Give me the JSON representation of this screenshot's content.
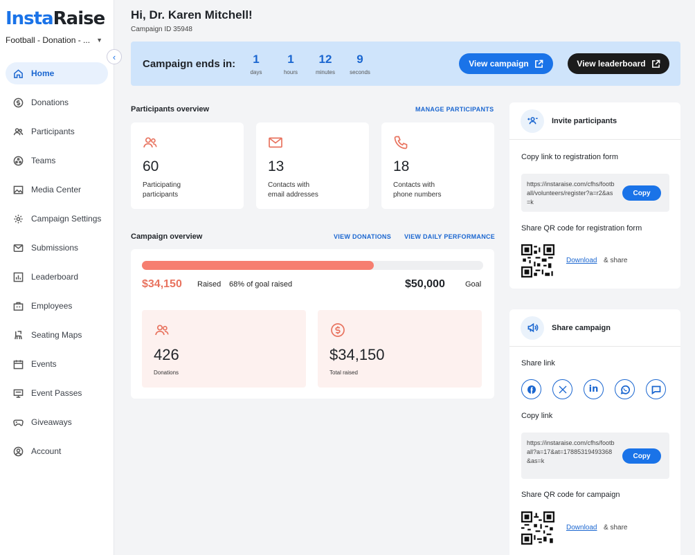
{
  "brand": {
    "part1": "Insta",
    "part2": "Raise"
  },
  "campaign_selector": {
    "value": "Football - Donation - ..."
  },
  "sidebar": {
    "items": [
      {
        "label": "Home",
        "icon": "home-icon"
      },
      {
        "label": "Donations",
        "icon": "dollar-circle-icon"
      },
      {
        "label": "Participants",
        "icon": "people-icon"
      },
      {
        "label": "Teams",
        "icon": "teams-icon"
      },
      {
        "label": "Media Center",
        "icon": "image-icon"
      },
      {
        "label": "Campaign Settings",
        "icon": "gear-icon"
      },
      {
        "label": "Submissions",
        "icon": "mail-icon"
      },
      {
        "label": "Leaderboard",
        "icon": "chart-icon"
      },
      {
        "label": "Employees",
        "icon": "briefcase-icon"
      },
      {
        "label": "Seating Maps",
        "icon": "seat-icon"
      },
      {
        "label": "Events",
        "icon": "calendar-icon"
      },
      {
        "label": "Event Passes",
        "icon": "pass-icon"
      },
      {
        "label": "Giveaways",
        "icon": "gamepad-icon"
      },
      {
        "label": "Account",
        "icon": "user-circle-icon"
      }
    ]
  },
  "header": {
    "greeting": "Hi, Dr. Karen Mitchell!",
    "campaign_id": "Campaign ID 35948"
  },
  "banner": {
    "label": "Campaign ends in:",
    "countdown": [
      {
        "value": "1",
        "unit": "days"
      },
      {
        "value": "1",
        "unit": "hours"
      },
      {
        "value": "12",
        "unit": "minutes"
      },
      {
        "value": "9",
        "unit": "seconds"
      }
    ],
    "view_campaign": "View campaign",
    "view_leaderboard": "View leaderboard"
  },
  "participants_overview": {
    "title": "Participants overview",
    "link": "MANAGE PARTICIPANTS",
    "cards": [
      {
        "value": "60",
        "line1": "Participating",
        "line2": "participants",
        "icon": "people-icon"
      },
      {
        "value": "13",
        "line1": "Contacts with",
        "line2": "email addresses",
        "icon": "mail-icon"
      },
      {
        "value": "18",
        "line1": "Contacts with",
        "line2": "phone numbers",
        "icon": "phone-icon"
      }
    ]
  },
  "campaign_overview": {
    "title": "Campaign overview",
    "link_donations": "VIEW DONATIONS",
    "link_daily": "VIEW DAILY PERFORMANCE",
    "progress_fraction": 0.68,
    "raised": "$34,150",
    "raised_label": "Raised",
    "percent_text": "68% of goal raised",
    "goal": "$50,000",
    "goal_label": "Goal",
    "stats": [
      {
        "value": "426",
        "label": "Donations",
        "icon": "people-icon"
      },
      {
        "value": "$34,150",
        "label": "Total raised",
        "icon": "dollar-circle-icon"
      }
    ]
  },
  "invite": {
    "title": "Invite participants",
    "copy_label": "Copy link to registration form",
    "link": "https://instaraise.com/cfhs/football/volunteers/register?a=r2&as=k",
    "copy_button": "Copy",
    "qr_label": "Share QR code for registration form",
    "download": "Download",
    "share": "& share"
  },
  "share_campaign": {
    "title": "Share campaign",
    "share_link_label": "Share link",
    "socials": [
      "facebook-icon",
      "x-icon",
      "linkedin-icon",
      "whatsapp-icon",
      "sms-icon"
    ],
    "copy_label": "Copy link",
    "link": "https://instaraise.com/cfhs/football?a=17&at=17885319493368&as=k",
    "copy_button": "Copy",
    "qr_label": "Share QR code for campaign",
    "download": "Download",
    "share": "& share"
  },
  "colors": {
    "accent": "#1a73e8",
    "coral": "#f67e70",
    "banner": "#cfe4fb"
  }
}
